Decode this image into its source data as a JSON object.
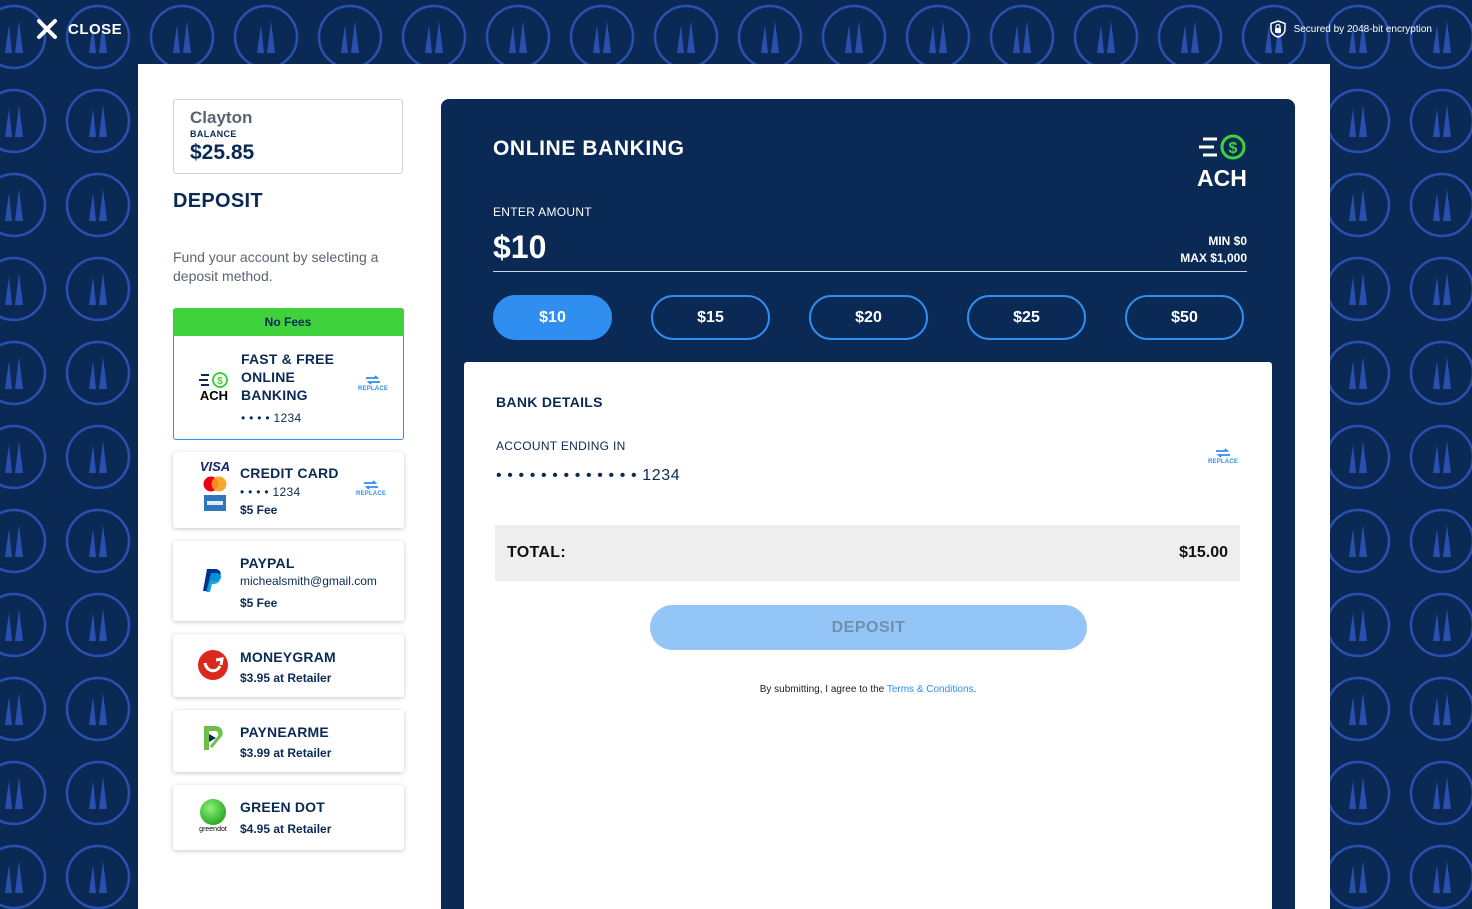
{
  "header": {
    "close_label": "CLOSE",
    "secured_text": "Secured by 2048-bit encryption"
  },
  "account": {
    "name": "Clayton",
    "balance_label": "BALANCE",
    "balance": "$25.85"
  },
  "sidebar": {
    "title": "DEPOSIT",
    "description": "Fund your account by selecting a deposit method.",
    "replace_label": "REPLACE",
    "methods": [
      {
        "banner": "No Fees",
        "title": "FAST & FREE ONLINE BANKING",
        "sub": "• • • • 1234",
        "logo": "ACH",
        "icon": "ach-icon"
      },
      {
        "title": "CREDIT CARD",
        "sub": "• • • • 1234",
        "fee": "$5 Fee",
        "logo": "VISA",
        "icon": "card-brands-icon"
      },
      {
        "title": "PAYPAL",
        "sub": "michealsmith@gmail.com",
        "fee": "$5 Fee",
        "icon": "paypal-icon"
      },
      {
        "title": "MONEYGRAM",
        "fee": "$3.95 at Retailer",
        "icon": "moneygram-icon"
      },
      {
        "title": "PAYNEARME",
        "fee": "$3.99 at Retailer",
        "icon": "paynearme-icon"
      },
      {
        "title": "GREEN DOT",
        "fee": "$4.95 at Retailer",
        "logo": "greendot",
        "icon": "greendot-icon"
      }
    ]
  },
  "online_banking": {
    "title": "ONLINE BANKING",
    "logo_text": "ACH",
    "enter_amount_label": "ENTER AMOUNT",
    "amount": "$10",
    "min": "MIN $0",
    "max": "MAX $1,000",
    "amount_options": [
      "$10",
      "$15",
      "$20",
      "$25",
      "$50"
    ],
    "selected_amount": "$10",
    "bank_details": {
      "title": "BANK DETAILS",
      "account_label": "ACCOUNT ENDING IN",
      "account_value": "• • • • • • • • • • • • •  1234",
      "replace_label": "REPLACE"
    },
    "total_label": "TOTAL:",
    "total_value": "$15.00",
    "deposit_label": "DEPOSIT",
    "terms_prefix": "By submitting, I agree to the ",
    "terms_link": "Terms & Conditions",
    "terms_suffix": "."
  },
  "colors": {
    "navy": "#0a2a55",
    "accent_blue": "#2f8ef0",
    "no_fees_green": "#3fd23c",
    "deposit_disabled": "#93c6f7"
  }
}
